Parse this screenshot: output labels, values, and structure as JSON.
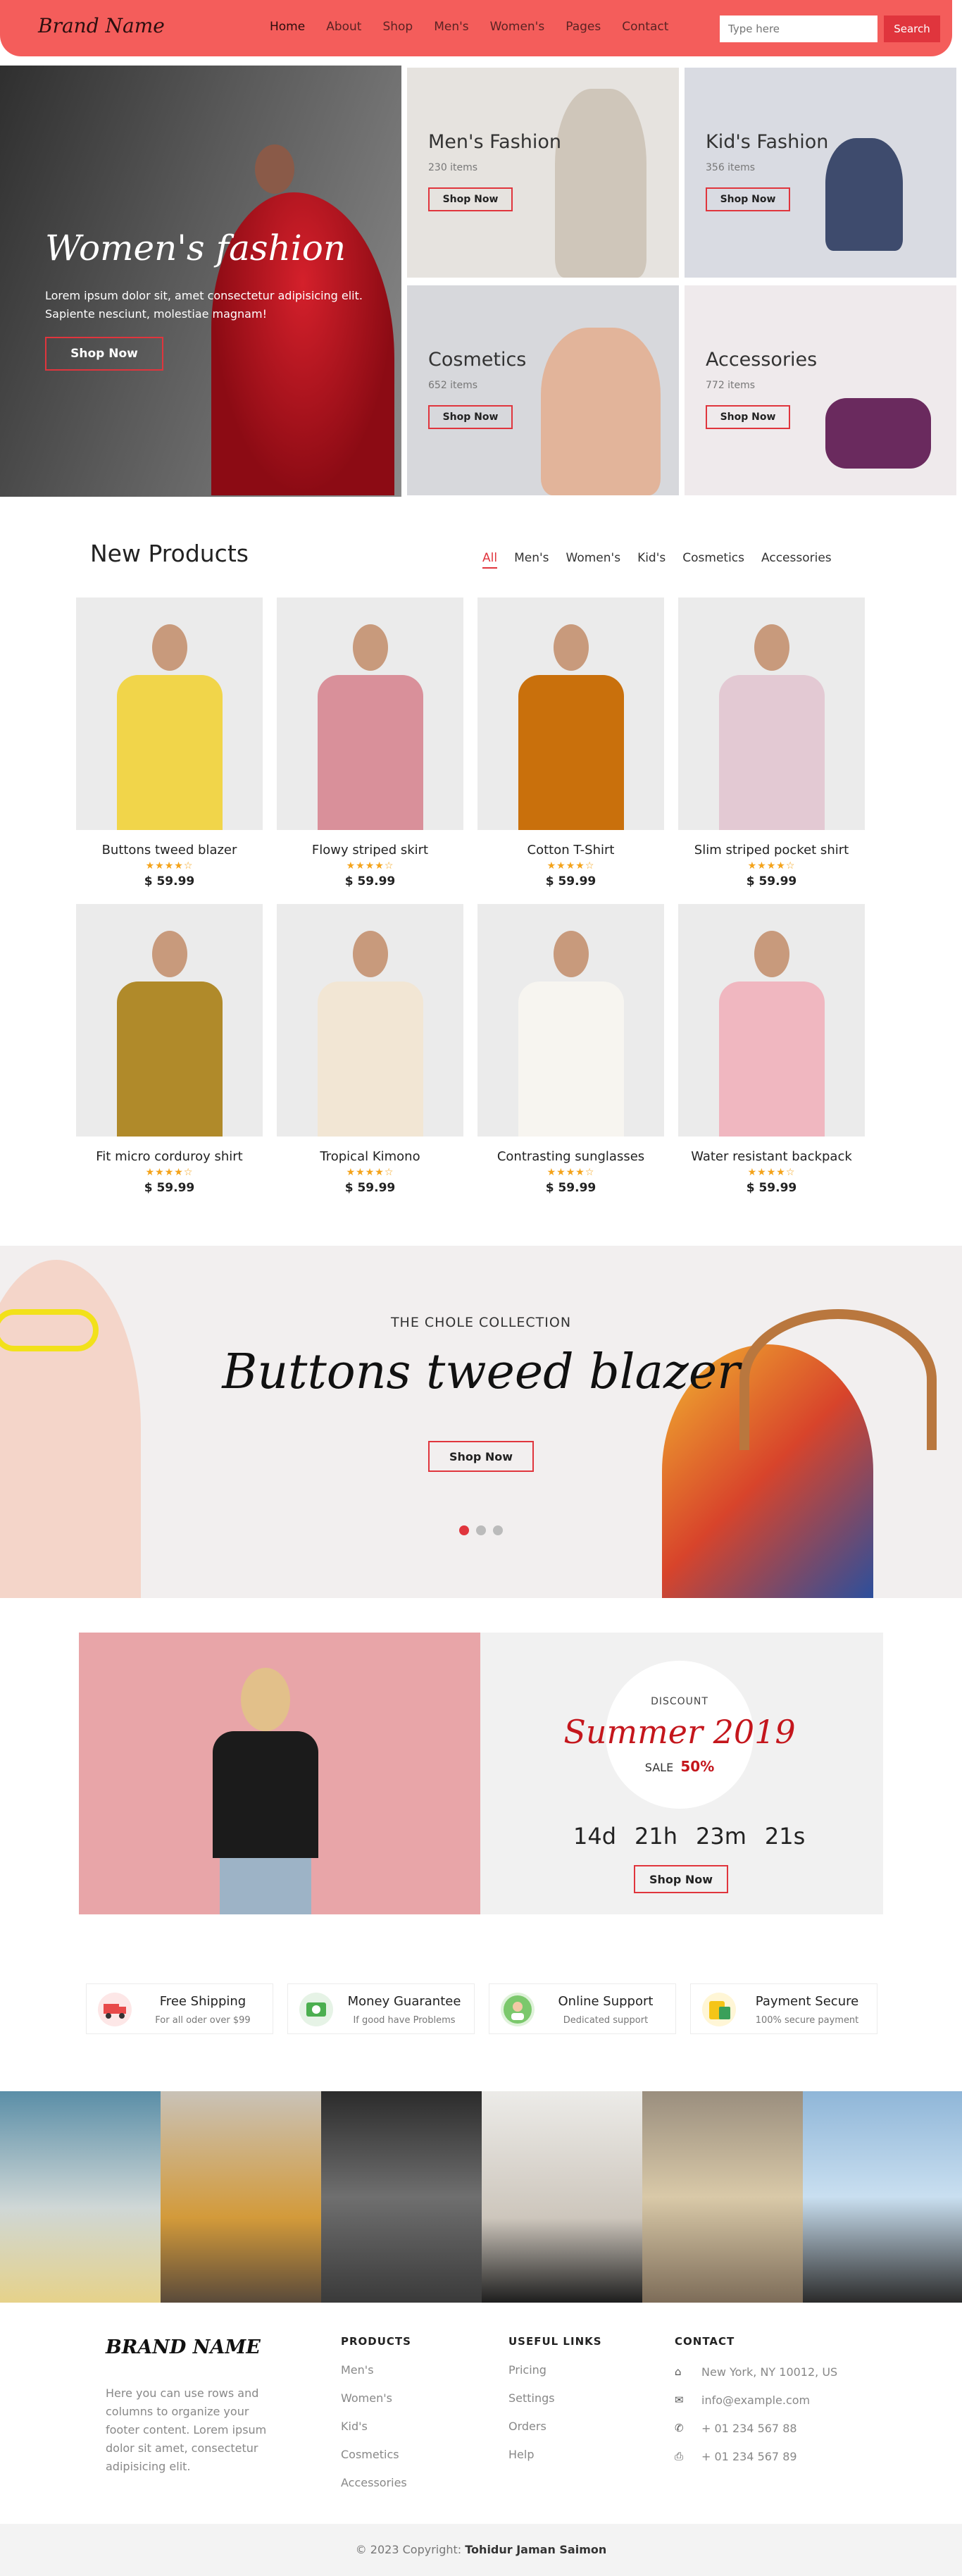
{
  "nav": {
    "brand": "Brand Name",
    "menu": [
      "Home",
      "About",
      "Shop",
      "Men's",
      "Women's",
      "Pages",
      "Contact"
    ],
    "search_placeholder": "Type here",
    "search_button": "Search",
    "bg_color": "#f45d5b"
  },
  "hero": {
    "title": "Women's fashion",
    "text": "Lorem ipsum dolor sit, amet consectetur adipisicing elit. Sapiente nesciunt, molestiae magnam!",
    "button": "Shop Now"
  },
  "categories": [
    {
      "title": "Men's Fashion",
      "count": "230 items",
      "button": "Shop Now"
    },
    {
      "title": "Kid's Fashion",
      "count": "356 items",
      "button": "Shop Now"
    },
    {
      "title": "Cosmetics",
      "count": "652 items",
      "button": "Shop Now"
    },
    {
      "title": "Accessories",
      "count": "772 items",
      "button": "Shop Now"
    }
  ],
  "new_products": {
    "title": "New Products",
    "filters": [
      "All",
      "Men's",
      "Women's",
      "Kid's",
      "Cosmetics",
      "Accessories"
    ],
    "rating_stars": "★★★★☆",
    "items": [
      {
        "name": "Buttons tweed blazer",
        "price": "$ 59.99",
        "color": "#f1d54a"
      },
      {
        "name": "Flowy striped skirt",
        "price": "$ 59.99",
        "color": "#d9909a"
      },
      {
        "name": "Cotton T-Shirt",
        "price": "$ 59.99",
        "color": "#c9700c"
      },
      {
        "name": "Slim striped pocket shirt",
        "price": "$ 59.99",
        "color": "#e3c9d3"
      },
      {
        "name": "Fit micro corduroy shirt",
        "price": "$ 59.99",
        "color": "#b08a2a"
      },
      {
        "name": "Tropical Kimono",
        "price": "$ 59.99",
        "color": "#f2e6d4"
      },
      {
        "name": "Contrasting sunglasses",
        "price": "$ 59.99",
        "color": "#f7f5f0"
      },
      {
        "name": "Water resistant backpack",
        "price": "$ 59.99",
        "color": "#f0b7c0"
      }
    ]
  },
  "collection": {
    "subtitle": "THE CHOLE COLLECTION",
    "title": "Buttons tweed blazer",
    "button": "Shop Now"
  },
  "sale": {
    "label": "DISCOUNT",
    "title": "Summer 2019",
    "sale_text": "SALE",
    "percent": "50%",
    "countdown": [
      "14d",
      "21h",
      "23m",
      "21s"
    ],
    "button": "Shop Now"
  },
  "features": [
    {
      "title": "Free Shipping",
      "subtitle": "For all oder over $99",
      "icon": "truck-icon",
      "color": "#e84a4a"
    },
    {
      "title": "Money Guarantee",
      "subtitle": "If good have Problems",
      "icon": "money-icon",
      "color": "#4caf50"
    },
    {
      "title": "Online Support",
      "subtitle": "Dedicated support",
      "icon": "support-icon",
      "color": "#7bc86c"
    },
    {
      "title": "Payment Secure",
      "subtitle": "100% secure payment",
      "icon": "payment-icon",
      "color": "#f5c518"
    }
  ],
  "footer": {
    "brand": "BRAND NAME",
    "about": "Here you can use rows and columns to organize your footer content. Lorem ipsum dolor sit amet, consectetur adipisicing elit.",
    "products_title": "PRODUCTS",
    "products": [
      "Men's",
      "Women's",
      "Kid's",
      "Cosmetics",
      "Accessories"
    ],
    "links_title": "USEFUL LINKS",
    "links": [
      "Pricing",
      "Settings",
      "Orders",
      "Help"
    ],
    "contact_title": "CONTACT",
    "contact": [
      {
        "icon": "home-icon",
        "text": "New York, NY 10012, US"
      },
      {
        "icon": "mail-icon",
        "text": "info@example.com"
      },
      {
        "icon": "phone-icon",
        "text": "+ 01 234 567 88"
      },
      {
        "icon": "print-icon",
        "text": "+ 01 234 567 89"
      }
    ]
  },
  "copyright": {
    "text": "© 2023 Copyright: ",
    "author": "Tohidur Jaman Saimon"
  }
}
